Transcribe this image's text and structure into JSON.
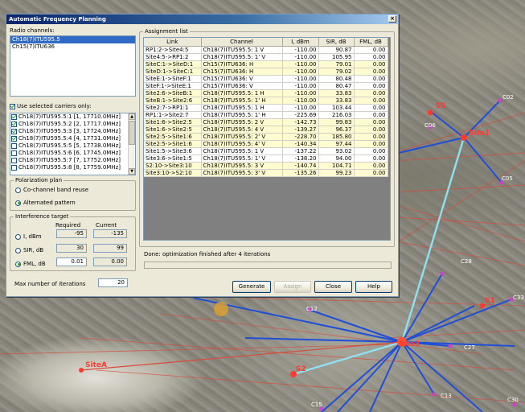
{
  "dialog": {
    "title": "Automatic Frequency Planning",
    "close_glyph": "×"
  },
  "radio_channels": {
    "label": "Radio channels:",
    "items": [
      {
        "label": "Ch18(7)ITU595.5",
        "selected": true
      },
      {
        "label": "Ch15(7)ITU636",
        "selected": false
      }
    ]
  },
  "carriers": {
    "use_selected_label": "Use selected carriers only:",
    "use_selected_checked": true,
    "items": [
      {
        "label": "Ch18(7)ITU595.5:1 [1, 17710.0MHz]",
        "checked": true
      },
      {
        "label": "Ch18(7)ITU595.5:2 [2, 17717.0MHz]",
        "checked": true
      },
      {
        "label": "Ch18(7)ITU595.5:3 [3, 17724.0MHz]",
        "checked": true
      },
      {
        "label": "Ch18(7)ITU595.5:4 [4, 17731.0MHz]",
        "checked": true
      },
      {
        "label": "Ch18(7)ITU595.5:5 [5, 17738.0MHz]",
        "checked": false
      },
      {
        "label": "Ch18(7)ITU595.5:6 [6, 17745.0MHz]",
        "checked": false
      },
      {
        "label": "Ch18(7)ITU595.5:7 [7, 17752.0MHz]",
        "checked": false
      },
      {
        "label": "Ch18(7)ITU595.5:8 [8, 17759.0MHz]",
        "checked": false
      }
    ]
  },
  "polarization": {
    "title": "Polarization plan",
    "options": [
      {
        "label": "Co-channel band reuse",
        "selected": false
      },
      {
        "label": "Alternated pattern",
        "selected": true
      }
    ]
  },
  "interference": {
    "title": "Interference target",
    "col_required": "Required",
    "col_current": "Current",
    "rows": [
      {
        "label": "I, dBm",
        "selected": false,
        "required": "-95",
        "current": "-135"
      },
      {
        "label": "SIR, dB",
        "selected": false,
        "required": "30",
        "current": "99"
      },
      {
        "label": "FML, dB",
        "selected": true,
        "required": "0.01",
        "current": "0.00"
      }
    ]
  },
  "iterations": {
    "label": "Max number of iterations",
    "value": "20"
  },
  "assignment": {
    "title": "Assignment list",
    "columns": [
      "Link",
      "Channel",
      "I, dBm",
      "SIR, dB",
      "FML, dB"
    ],
    "rows": [
      {
        "link": "RP1:2->Site4:5",
        "channel": "Ch18(7)ITU595.5: 1 V",
        "i": "-110.00",
        "sir": "90.87",
        "fml": "0.00",
        "hl": false
      },
      {
        "link": "Site4:5->RP1:2",
        "channel": "Ch18(7)ITU595.5: 1' V",
        "i": "-110.00",
        "sir": "105.95",
        "fml": "0.00",
        "hl": false
      },
      {
        "link": "SiteC:1->SiteD:1",
        "channel": "Ch15(7)ITU636: H",
        "i": "-110.00",
        "sir": "79.01",
        "fml": "0.00",
        "hl": true
      },
      {
        "link": "SiteD:1->SiteC:1",
        "channel": "Ch15(7)ITU636: H",
        "i": "-110.00",
        "sir": "79.02",
        "fml": "0.00",
        "hl": true
      },
      {
        "link": "SiteE:1->SiteF:1",
        "channel": "Ch15(7)ITU636: V",
        "i": "-110.00",
        "sir": "80.48",
        "fml": "0.00",
        "hl": false
      },
      {
        "link": "SiteF:1->SiteE:1",
        "channel": "Ch15(7)ITU636: V",
        "i": "-110.00",
        "sir": "80.47",
        "fml": "0.00",
        "hl": false
      },
      {
        "link": "Site2:6->SiteB:1",
        "channel": "Ch18(7)ITU595.5: 1 H",
        "i": "-110.00",
        "sir": "33.83",
        "fml": "0.00",
        "hl": true
      },
      {
        "link": "SiteB:1->Site2:6",
        "channel": "Ch18(7)ITU595.5: 1' H",
        "i": "-110.00",
        "sir": "33.83",
        "fml": "0.00",
        "hl": true
      },
      {
        "link": "Site2:7->RP1:1",
        "channel": "Ch18(7)ITU595.5: 1 H",
        "i": "-110.00",
        "sir": "103.44",
        "fml": "0.00",
        "hl": false
      },
      {
        "link": "RP1:1->Site2:7",
        "channel": "Ch18(7)ITU595.5: 1' H",
        "i": "-225.69",
        "sir": "216.03",
        "fml": "0.00",
        "hl": false
      },
      {
        "link": "Site1:6->Site2:5",
        "channel": "Ch18(7)ITU595.5: 2 V",
        "i": "-142.73",
        "sir": "99.83",
        "fml": "0.00",
        "hl": true
      },
      {
        "link": "Site1:6->Site2:5",
        "channel": "Ch18(7)ITU595.5: 4 V",
        "i": "-139.27",
        "sir": "96.37",
        "fml": "0.00",
        "hl": true
      },
      {
        "link": "Site2:5->Site1:6",
        "channel": "Ch18(7)ITU595.5: 2' V",
        "i": "-228.70",
        "sir": "185.80",
        "fml": "0.00",
        "hl": true
      },
      {
        "link": "Site2:5->Site1:6",
        "channel": "Ch18(7)ITU595.5: 4' V",
        "i": "-140.34",
        "sir": "97.44",
        "fml": "0.00",
        "hl": true
      },
      {
        "link": "Site1:5->Site3:6",
        "channel": "Ch18(7)ITU595.5: 1 V",
        "i": "-137.22",
        "sir": "93.02",
        "fml": "0.00",
        "hl": false
      },
      {
        "link": "Site3:6->Site1:5",
        "channel": "Ch18(7)ITU595.5: 1' V",
        "i": "-138.20",
        "sir": "94.00",
        "fml": "0.00",
        "hl": false
      },
      {
        "link": "S2:10->Site3:10",
        "channel": "Ch18(7)ITU595.5: 3 V",
        "i": "-140.74",
        "sir": "104.71",
        "fml": "0.00",
        "hl": true
      },
      {
        "link": "Site3:10->S2:10",
        "channel": "Ch18(7)ITU595.5: 3' V",
        "i": "-135.26",
        "sir": "99.23",
        "fml": "0.00",
        "hl": true
      }
    ]
  },
  "status": {
    "text": "Done: optimization finished after 4 iterations",
    "progress": 0
  },
  "buttons": {
    "generate": "Generate",
    "assign": "Assign",
    "close": "Close",
    "help": "Help"
  },
  "map": {
    "sites": [
      {
        "label": "S5"
      },
      {
        "label": "Site1"
      },
      {
        "label": "S1"
      },
      {
        "label": "Site3"
      },
      {
        "label": "S2"
      },
      {
        "label": "SiteA"
      }
    ],
    "cells": [
      "C02",
      "C06",
      "C05",
      "C28",
      "C33",
      "C12",
      "C27",
      "C13",
      "C15",
      "C30"
    ],
    "colors": {
      "link_blue": "#1f4fd8",
      "link_red": "#d84a3a",
      "link_cyan": "#8fe0f0",
      "site_red": "#ff3b2f"
    }
  }
}
